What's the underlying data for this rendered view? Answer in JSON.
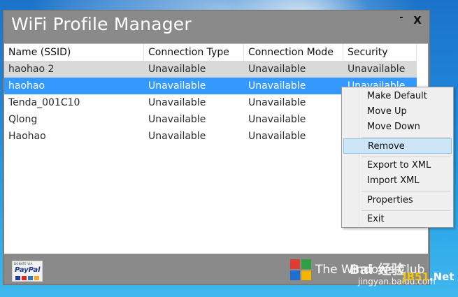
{
  "window": {
    "title": "WiFi Profile Manager",
    "minimize_glyph": "-",
    "close_glyph": "X"
  },
  "table": {
    "columns": [
      "Name (SSID)",
      "Connection Type",
      "Connection Mode",
      "Security"
    ],
    "rows": [
      {
        "name": "haohao 2",
        "type": "Unavailable",
        "mode": "Unavailable",
        "security": "Unavailable",
        "state": "selected-inactive"
      },
      {
        "name": "haohao",
        "type": "Unavailable",
        "mode": "Unavailable",
        "security": "Unavailable",
        "state": "selected"
      },
      {
        "name": "Tenda_001C10",
        "type": "Unavailable",
        "mode": "Unavailable",
        "security": "",
        "state": "normal"
      },
      {
        "name": "Qlong",
        "type": "Unavailable",
        "mode": "Unavailable",
        "security": "",
        "state": "normal"
      },
      {
        "name": "Haohao",
        "type": "Unavailable",
        "mode": "Unavailable",
        "security": "",
        "state": "normal"
      }
    ]
  },
  "context_menu": {
    "items": [
      "Make Default",
      "Move Up",
      "Move Down",
      "Remove",
      "Export to XML",
      "Import XML",
      "Properties",
      "Exit"
    ],
    "highlighted": "Remove"
  },
  "footer": {
    "donate_small": "DONATE VIA",
    "donate_logo": "PayPal",
    "brand_text": "The Windows Club"
  },
  "watermark": {
    "line1": "Bai 经验",
    "line2": "jingyan.baidu.com",
    "jb_a": "JB51",
    "jb_b": ".Net"
  },
  "colors": {
    "selected_blue": "#3399ff",
    "selected_gray": "#d9d9d9",
    "window_gray": "#8a8a8a",
    "menu_highlight": "#cde6f7"
  }
}
